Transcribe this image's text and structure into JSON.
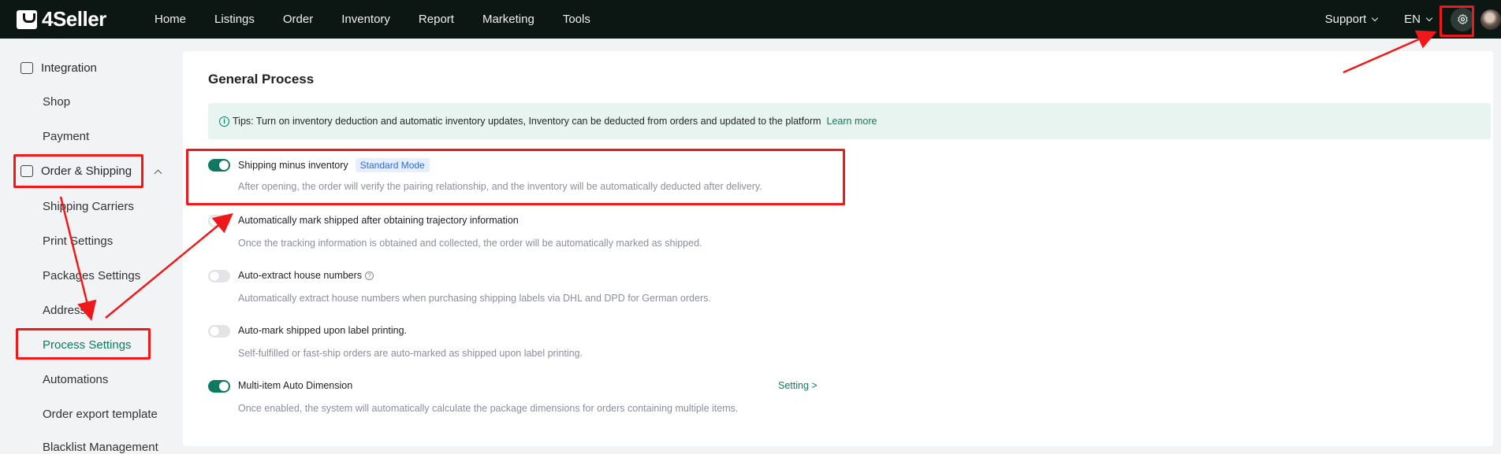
{
  "app": {
    "logo_text": "4Seller"
  },
  "nav": [
    "Home",
    "Listings",
    "Order",
    "Inventory",
    "Report",
    "Marketing",
    "Tools"
  ],
  "top_right": {
    "support": "Support",
    "language": "EN"
  },
  "sidebar": {
    "groups": [
      {
        "label": "Integration",
        "items": [
          "Shop",
          "Payment"
        ]
      },
      {
        "label": "Order & Shipping",
        "items": [
          "Shipping Carriers",
          "Print Settings",
          "Packages Settings",
          "Address",
          "Process Settings",
          "Automations",
          "Order export template",
          "Blacklist Management"
        ]
      }
    ],
    "active_item": "Process Settings"
  },
  "main": {
    "title": "General Process",
    "tip_text": "Tips: Turn on inventory deduction and automatic inventory updates, Inventory can be deducted from orders and updated to the platform",
    "tip_link": "Learn more",
    "options": [
      {
        "title": "Shipping minus inventory",
        "tag": "Standard Mode",
        "desc": "After opening, the order will verify the pairing relationship, and the inventory will be automatically deducted after delivery.",
        "enabled": true
      },
      {
        "title": "Automatically mark shipped after obtaining trajectory information",
        "desc": "Once the tracking information is obtained and collected, the order will be automatically marked as shipped.",
        "enabled": false
      },
      {
        "title": "Auto-extract house numbers",
        "desc": "Automatically extract house numbers when purchasing shipping labels via DHL and DPD for German orders.",
        "enabled": false
      },
      {
        "title": "Auto-mark shipped upon label printing.",
        "desc": "Self-fulfilled or fast-ship orders are auto-marked as shipped upon label printing.",
        "enabled": false
      },
      {
        "title": "Multi-item Auto Dimension",
        "desc": "Once enabled, the system will automatically calculate the package dimensions for orders containing multiple items.",
        "enabled": true,
        "link": "Setting >"
      }
    ]
  },
  "colors": {
    "accent": "#0f7a5f",
    "topbar": "#0c1612",
    "annotation": "#f01818"
  }
}
